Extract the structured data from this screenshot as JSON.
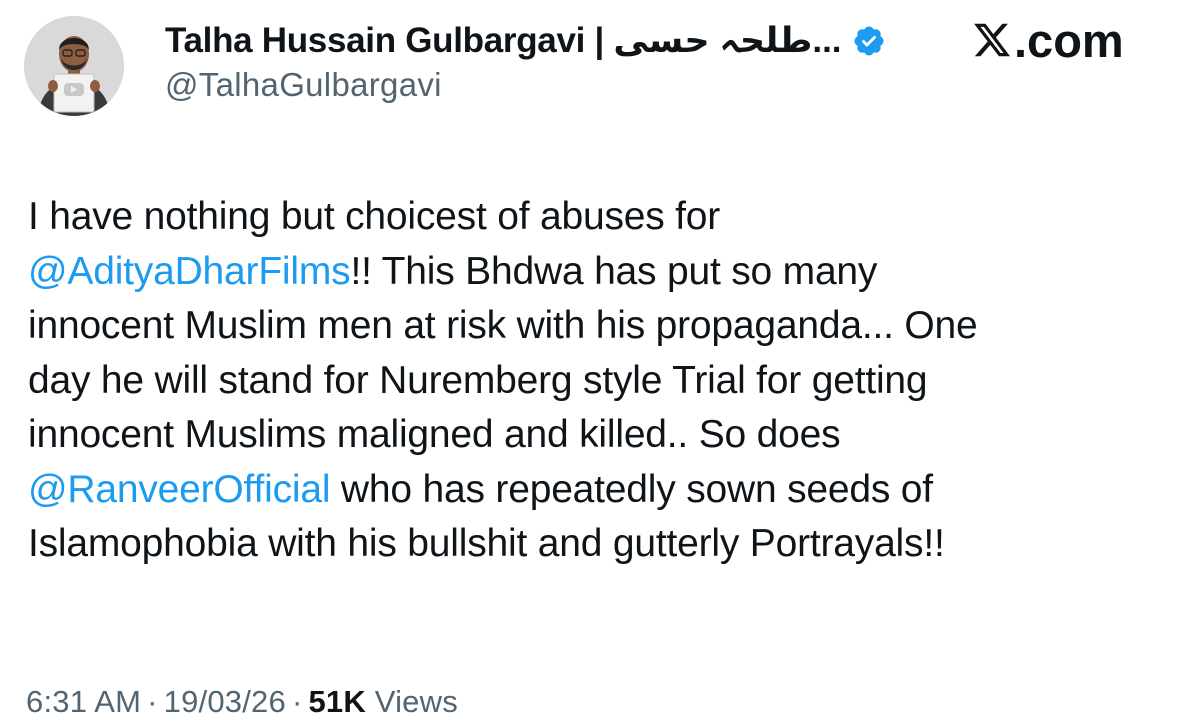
{
  "author": {
    "display_name": "Talha Hussain Gulbargavi | طلحہ حسی...",
    "handle": "@TalhaGulbargavi",
    "verified": true,
    "avatar_icon": "avatar-photo-icon"
  },
  "brand": {
    "logo_text": ".com",
    "logo_icon": "x-logo-icon"
  },
  "tweet": {
    "lines": [
      [
        {
          "text": "I have nothing but choicest of abuses for",
          "mention": false
        }
      ],
      [
        {
          "text": "@AdityaDharFilms",
          "mention": true
        },
        {
          "text": "!! This Bhdwa has put so many",
          "mention": false
        }
      ],
      [
        {
          "text": "innocent Muslim men at risk with his propaganda... One",
          "mention": false
        }
      ],
      [
        {
          "text": "day he will stand for Nuremberg style Trial for getting",
          "mention": false
        }
      ],
      [
        {
          "text": "innocent Muslims maligned and killed.. So does",
          "mention": false
        }
      ],
      [
        {
          "text": "@RanveerOfficial",
          "mention": true
        },
        {
          "text": " who has repeatedly sown seeds of",
          "mention": false
        }
      ],
      [
        {
          "text": "Islamophobia with his bullshit and gutterly Portrayals!!",
          "mention": false
        }
      ]
    ]
  },
  "meta": {
    "time": "6:31 AM",
    "date": "19/03/26",
    "views_count": "51K",
    "views_label": "Views"
  },
  "colors": {
    "mention": "#1d9bf0",
    "text": "#0f1419",
    "secondary": "#536471",
    "verified": "#1d9bf0"
  }
}
